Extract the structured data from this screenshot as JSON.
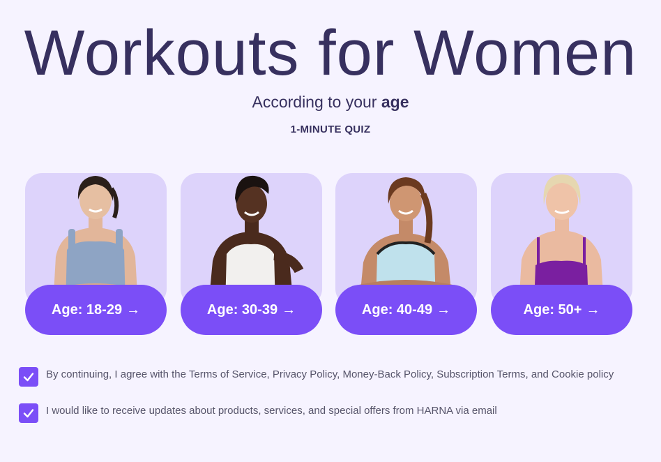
{
  "header": {
    "title": "Workouts for Women",
    "subtitle_prefix": "According to your",
    "subtitle_emphasis": "age",
    "quiz_label": "1-MINUTE QUIZ"
  },
  "age_cards": [
    {
      "label": "Age: 18-29",
      "arrow": "→"
    },
    {
      "label": "Age: 30-39",
      "arrow": "→"
    },
    {
      "label": "Age: 40-49",
      "arrow": "→"
    },
    {
      "label": "Age: 50+",
      "arrow": "→"
    }
  ],
  "consents": [
    {
      "text": "By continuing, I agree with the Terms of Service, Privacy Policy, Money-Back Policy, Subscription Terms, and Cookie policy",
      "checked": true
    },
    {
      "text": "I would like to receive updates about products, services, and special offers from HARNA via email",
      "checked": true
    }
  ],
  "colors": {
    "background": "#f6f3ff",
    "accent": "#7b4ef7",
    "card_bg": "#ddd3fb",
    "title": "#37305f"
  }
}
